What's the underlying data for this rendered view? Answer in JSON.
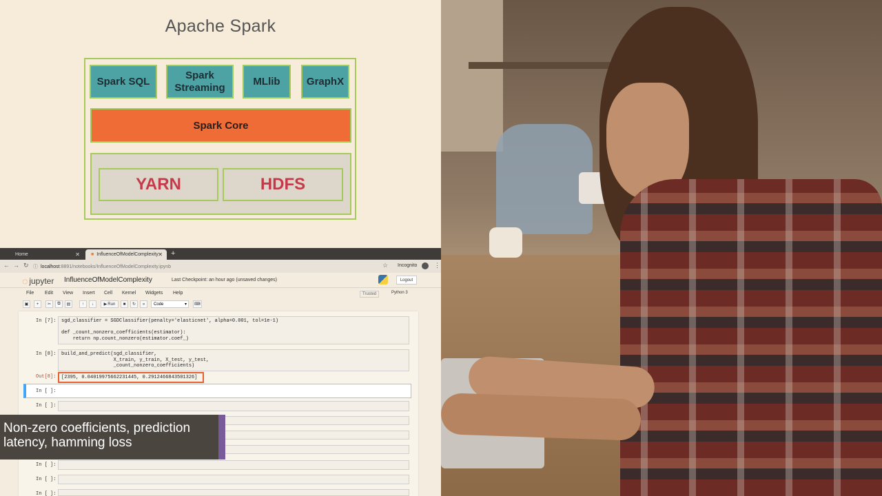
{
  "slide": {
    "title": "Apache Spark",
    "libraries": [
      "Spark SQL",
      "Spark Streaming",
      "MLlib",
      "GraphX"
    ],
    "core": "Spark Core",
    "cluster": [
      "YARN",
      "HDFS"
    ]
  },
  "browser": {
    "tabs": [
      {
        "label": "Home"
      },
      {
        "label": "InfluenceOfModelComplexity"
      }
    ],
    "url_host": "localhost",
    "url_path": ":8891/notebooks/InfluenceOfModelComplexity.ipynb",
    "incognito": "Incognito"
  },
  "jupyter": {
    "logo": "jupyter",
    "notebook_name": "InfluenceOfModelComplexity",
    "checkpoint": "Last Checkpoint: an hour ago  (unsaved changes)",
    "logout": "Logout",
    "menu": [
      "File",
      "Edit",
      "View",
      "Insert",
      "Cell",
      "Kernel",
      "Widgets",
      "Help"
    ],
    "trusted": "Trusted",
    "kernel": "Python 3",
    "run_label": "Run",
    "cell_type": "Code"
  },
  "cells": {
    "c7": {
      "prompt": "In [7]:",
      "code": "sgd_classifier = SGDClassifier(penalty='elasticnet', alpha=0.001, tol=1e-1)\n\ndef _count_nonzero_coefficients(estimator):\n    return np.count_nonzero(estimator.coef_)"
    },
    "c8": {
      "prompt": "In [8]:",
      "code": "build_and_predict(sgd_classifier,\n                  X_train, y_train, X_test, y_test,\n                  _count_nonzero_coefficients)"
    },
    "out8": {
      "prompt": "Out[8]:",
      "value": "[2395, 0.04019975662231445, 0.2912466843501326]"
    },
    "empty_prompt": "In [ ]:"
  },
  "caption": "Non-zero coefficients, prediction latency, hamming loss",
  "colors": {
    "background": "#f6ecd9",
    "green_border": "#a6c95b",
    "teal": "#4da3a3",
    "orange": "#ef6c37",
    "cluster_text": "#c53a4b",
    "highlight": "#e8602f",
    "caption_bg": "#4b4540",
    "caption_accent": "#7a5b9a"
  }
}
